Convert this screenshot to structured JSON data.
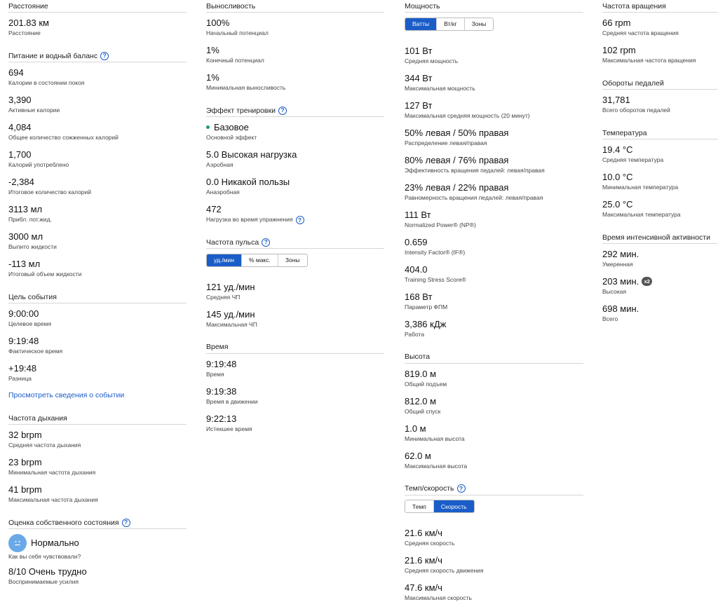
{
  "col1": {
    "distance": {
      "title": "Расстояние",
      "stats": [
        {
          "value": "201.83 км",
          "label": "Расстояние"
        }
      ]
    },
    "nutrition": {
      "title": "Питание и водный баланс",
      "stats": [
        {
          "value": "694",
          "label": "Калории в состоянии покоя"
        },
        {
          "value": "3,390",
          "label": "Активные калории"
        },
        {
          "value": "4,084",
          "label": "Общее количество сожженных калорий"
        },
        {
          "value": "1,700",
          "label": "Калорий употреблено"
        },
        {
          "value": "-2,384",
          "label": "Итоговое количество калорий"
        },
        {
          "value": "3113 мл",
          "label": "Прибл. пот.жид."
        },
        {
          "value": "3000 мл",
          "label": "Выпито жидкости"
        },
        {
          "value": "-113 мл",
          "label": "Итоговый объем жидкости"
        }
      ]
    },
    "event": {
      "title": "Цель события",
      "stats": [
        {
          "value": "9:00:00",
          "label": "Целевое время"
        },
        {
          "value": "9:19:48",
          "label": "Фактическое время"
        },
        {
          "value": "+19:48",
          "label": "Разница"
        }
      ],
      "link": "Просмотреть сведения о событии"
    },
    "respiration": {
      "title": "Частота дыхания",
      "stats": [
        {
          "value": "32 brpm",
          "label": "Средняя частота дыхания"
        },
        {
          "value": "23 brpm",
          "label": "Минимальная частота дыхания"
        },
        {
          "value": "41 brpm",
          "label": "Максимальная частота дыхания"
        }
      ]
    },
    "self_eval": {
      "title": "Оценка собственного состояния",
      "feel": {
        "value": "Нормально",
        "label": "Как вы себя чувствовали?"
      },
      "effort": {
        "value": "8/10 Очень трудно",
        "label": "Воспринимаемые усилия"
      }
    }
  },
  "col2": {
    "stamina": {
      "title": "Выносливость",
      "stats": [
        {
          "value": "100%",
          "label": "Начальный потенциал"
        },
        {
          "value": "1%",
          "label": "Конечный потенциал"
        },
        {
          "value": "1%",
          "label": "Минимальная выносливость"
        }
      ]
    },
    "training_effect": {
      "title": "Эффект тренировки",
      "stats": [
        {
          "value": "Базовое",
          "label": "Основной эффект"
        },
        {
          "value": "5.0 Высокая нагрузка",
          "label": "Аэробная"
        },
        {
          "value": "0.0 Никакой пользы",
          "label": "Анаэробная"
        },
        {
          "value": "472",
          "label": "Нагрузка во время упражнения"
        }
      ]
    },
    "heart_rate": {
      "title": "Частота пульса",
      "toggle": [
        "уд./мин",
        "% макс.",
        "Зоны"
      ],
      "stats": [
        {
          "value": "121 уд./мин",
          "label": "Средняя ЧП"
        },
        {
          "value": "145 уд./мин",
          "label": "Максимальная ЧП"
        }
      ]
    },
    "time": {
      "title": "Время",
      "stats": [
        {
          "value": "9:19:48",
          "label": "Время"
        },
        {
          "value": "9:19:38",
          "label": "Время в движении"
        },
        {
          "value": "9:22:13",
          "label": "Истекшее время"
        }
      ]
    }
  },
  "col3": {
    "power": {
      "title": "Мощность",
      "toggle": [
        "Ватты",
        "Вт/кг",
        "Зоны"
      ],
      "stats": [
        {
          "value": "101 Вт",
          "label": "Средняя мощность"
        },
        {
          "value": "344 Вт",
          "label": "Максимальная мощность"
        },
        {
          "value": "127 Вт",
          "label": "Максимальная средняя мощность (20 минут)"
        },
        {
          "value": "50% левая / 50% правая",
          "label": "Распределение левая/правая"
        },
        {
          "value": "80% левая / 76% правая",
          "label": "Эффективность вращения педалей: левая/правая"
        },
        {
          "value": "23% левая / 22% правая",
          "label": "Равномерность вращения педалей: левая/правая"
        },
        {
          "value": "111 Вт",
          "label": "Normalized Power® (NP®)"
        },
        {
          "value": "0.659",
          "label": "Intensity Factor® (IF®)"
        },
        {
          "value": "404.0",
          "label": "Training Stress Score®"
        },
        {
          "value": "168 Вт",
          "label": "Параметр ФПМ"
        },
        {
          "value": "3,386 кДж",
          "label": "Работа"
        }
      ]
    },
    "elevation": {
      "title": "Высота",
      "stats": [
        {
          "value": "819.0 м",
          "label": "Общий подъем"
        },
        {
          "value": "812.0 м",
          "label": "Общий спуск"
        },
        {
          "value": "1.0 м",
          "label": "Минимальная высота"
        },
        {
          "value": "62.0 м",
          "label": "Максимальная высота"
        }
      ]
    },
    "pace_speed": {
      "title": "Темп/скорость",
      "toggle": [
        "Темп",
        "Скорость"
      ],
      "stats": [
        {
          "value": "21.6 км/ч",
          "label": "Средняя скорость"
        },
        {
          "value": "21.6 км/ч",
          "label": "Средняя скорость движения"
        },
        {
          "value": "47.6 км/ч",
          "label": "Максимальная скорость"
        }
      ]
    }
  },
  "col4": {
    "cadence": {
      "title": "Частота вращения",
      "stats": [
        {
          "value": "66 rpm",
          "label": "Средняя частота вращения"
        },
        {
          "value": "102 rpm",
          "label": "Максимальная частота вращения"
        }
      ]
    },
    "strokes": {
      "title": "Обороты педалей",
      "stats": [
        {
          "value": "31,781",
          "label": "Всего оборотов педалей"
        }
      ]
    },
    "temperature": {
      "title": "Температура",
      "stats": [
        {
          "value": "19.4 °C",
          "label": "Средняя температура"
        },
        {
          "value": "10.0 °C",
          "label": "Минимальная температура"
        },
        {
          "value": "25.0 °C",
          "label": "Максимальная температура"
        }
      ]
    },
    "intensity": {
      "title": "Время интенсивной активности",
      "badge": "x2",
      "stats": [
        {
          "value": "292 мин.",
          "label": "Умеренная"
        },
        {
          "value": "203 мин.",
          "label": "Высокая"
        },
        {
          "value": "698 мин.",
          "label": "Всего"
        }
      ]
    }
  },
  "icons": {
    "help": "?",
    "feel": "neutral-face-icon"
  },
  "colors": {
    "accent": "#1a5dc8",
    "effect_dot": "#1f9e61",
    "face": "#6aa9e8"
  }
}
